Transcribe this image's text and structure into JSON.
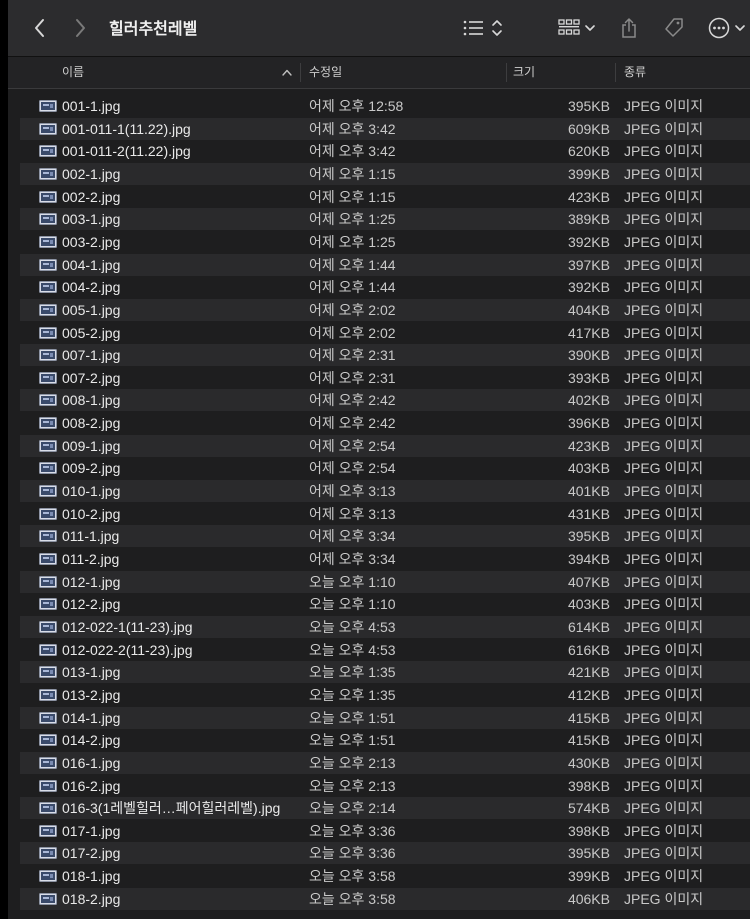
{
  "toolbar": {
    "title": "힐러추천레벨",
    "icons": [
      "back-chevron",
      "forward-chevron",
      "list-view",
      "sort-updown",
      "gallery-grid",
      "dropdown-chevron",
      "share",
      "tag",
      "more-ellipsis"
    ]
  },
  "columns": {
    "name": "이름",
    "date": "수정일",
    "size": "크기",
    "kind": "종류"
  },
  "files": [
    {
      "name": "001-1.jpg",
      "date": "어제 오후 12:58",
      "size": "395KB",
      "kind": "JPEG 이미지"
    },
    {
      "name": "001-011-1(11.22).jpg",
      "date": "어제 오후 3:42",
      "size": "609KB",
      "kind": "JPEG 이미지"
    },
    {
      "name": "001-011-2(11.22).jpg",
      "date": "어제 오후 3:42",
      "size": "620KB",
      "kind": "JPEG 이미지"
    },
    {
      "name": "002-1.jpg",
      "date": "어제 오후 1:15",
      "size": "399KB",
      "kind": "JPEG 이미지"
    },
    {
      "name": "002-2.jpg",
      "date": "어제 오후 1:15",
      "size": "423KB",
      "kind": "JPEG 이미지"
    },
    {
      "name": "003-1.jpg",
      "date": "어제 오후 1:25",
      "size": "389KB",
      "kind": "JPEG 이미지"
    },
    {
      "name": "003-2.jpg",
      "date": "어제 오후 1:25",
      "size": "392KB",
      "kind": "JPEG 이미지"
    },
    {
      "name": "004-1.jpg",
      "date": "어제 오후 1:44",
      "size": "397KB",
      "kind": "JPEG 이미지"
    },
    {
      "name": "004-2.jpg",
      "date": "어제 오후 1:44",
      "size": "392KB",
      "kind": "JPEG 이미지"
    },
    {
      "name": "005-1.jpg",
      "date": "어제 오후 2:02",
      "size": "404KB",
      "kind": "JPEG 이미지"
    },
    {
      "name": "005-2.jpg",
      "date": "어제 오후 2:02",
      "size": "417KB",
      "kind": "JPEG 이미지"
    },
    {
      "name": "007-1.jpg",
      "date": "어제 오후 2:31",
      "size": "390KB",
      "kind": "JPEG 이미지"
    },
    {
      "name": "007-2.jpg",
      "date": "어제 오후 2:31",
      "size": "393KB",
      "kind": "JPEG 이미지"
    },
    {
      "name": "008-1.jpg",
      "date": "어제 오후 2:42",
      "size": "402KB",
      "kind": "JPEG 이미지"
    },
    {
      "name": "008-2.jpg",
      "date": "어제 오후 2:42",
      "size": "396KB",
      "kind": "JPEG 이미지"
    },
    {
      "name": "009-1.jpg",
      "date": "어제 오후 2:54",
      "size": "423KB",
      "kind": "JPEG 이미지"
    },
    {
      "name": "009-2.jpg",
      "date": "어제 오후 2:54",
      "size": "403KB",
      "kind": "JPEG 이미지"
    },
    {
      "name": "010-1.jpg",
      "date": "어제 오후 3:13",
      "size": "401KB",
      "kind": "JPEG 이미지"
    },
    {
      "name": "010-2.jpg",
      "date": "어제 오후 3:13",
      "size": "431KB",
      "kind": "JPEG 이미지"
    },
    {
      "name": "011-1.jpg",
      "date": "어제 오후 3:34",
      "size": "395KB",
      "kind": "JPEG 이미지"
    },
    {
      "name": "011-2.jpg",
      "date": "어제 오후 3:34",
      "size": "394KB",
      "kind": "JPEG 이미지"
    },
    {
      "name": "012-1.jpg",
      "date": "오늘 오후 1:10",
      "size": "407KB",
      "kind": "JPEG 이미지"
    },
    {
      "name": "012-2.jpg",
      "date": "오늘 오후 1:10",
      "size": "403KB",
      "kind": "JPEG 이미지"
    },
    {
      "name": "012-022-1(11-23).jpg",
      "date": "오늘 오후 4:53",
      "size": "614KB",
      "kind": "JPEG 이미지"
    },
    {
      "name": "012-022-2(11-23).jpg",
      "date": "오늘 오후 4:53",
      "size": "616KB",
      "kind": "JPEG 이미지"
    },
    {
      "name": "013-1.jpg",
      "date": "오늘 오후 1:35",
      "size": "421KB",
      "kind": "JPEG 이미지"
    },
    {
      "name": "013-2.jpg",
      "date": "오늘 오후 1:35",
      "size": "412KB",
      "kind": "JPEG 이미지"
    },
    {
      "name": "014-1.jpg",
      "date": "오늘 오후 1:51",
      "size": "415KB",
      "kind": "JPEG 이미지"
    },
    {
      "name": "014-2.jpg",
      "date": "오늘 오후 1:51",
      "size": "415KB",
      "kind": "JPEG 이미지"
    },
    {
      "name": "016-1.jpg",
      "date": "오늘 오후 2:13",
      "size": "430KB",
      "kind": "JPEG 이미지"
    },
    {
      "name": "016-2.jpg",
      "date": "오늘 오후 2:13",
      "size": "398KB",
      "kind": "JPEG 이미지"
    },
    {
      "name": "016-3(1레벨힐러…페어힐러레벨).jpg",
      "date": "오늘 오후 2:14",
      "size": "574KB",
      "kind": "JPEG 이미지"
    },
    {
      "name": "017-1.jpg",
      "date": "오늘 오후 3:36",
      "size": "398KB",
      "kind": "JPEG 이미지"
    },
    {
      "name": "017-2.jpg",
      "date": "오늘 오후 3:36",
      "size": "395KB",
      "kind": "JPEG 이미지"
    },
    {
      "name": "018-1.jpg",
      "date": "오늘 오후 3:58",
      "size": "399KB",
      "kind": "JPEG 이미지"
    },
    {
      "name": "018-2.jpg",
      "date": "오늘 오후 3:58",
      "size": "406KB",
      "kind": "JPEG 이미지"
    }
  ]
}
